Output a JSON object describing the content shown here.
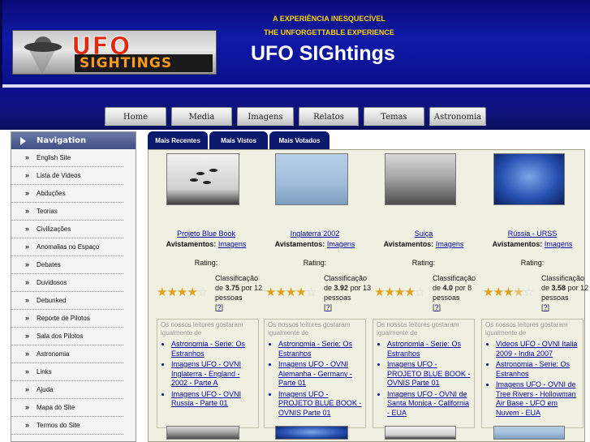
{
  "header": {
    "logo_ufo": "UFO",
    "logo_sightings": "SIGHTINGS",
    "tagline_pt": "A EXPERIÊNCIA INESQUECÍVEL",
    "tagline_en": "THE UNFORGETTABLE EXPERIENCE",
    "title": "UFO SIGhtings"
  },
  "nav_tabs": [
    "Home",
    "Media",
    "Imagens",
    "Relatos",
    "Temas",
    "Astronomia"
  ],
  "sidebar": {
    "title": "Navigation",
    "items": [
      "English Site",
      "Lista de Videos",
      "Abduções",
      "Teorias",
      "Civilizações",
      "Anomalias no Espaço",
      "Debates",
      "Duvidosos",
      "Debunked",
      "Reporte de Pilotos",
      "Sala dos Pilotos",
      "Astronomia",
      "Links",
      "Ajuda",
      "Mapa do Site",
      "Termos do Site"
    ]
  },
  "main_tabs": [
    "Mais Recentes",
    "Mais Vistos",
    "Mais Votados"
  ],
  "common": {
    "views_label": "Avistamentos:",
    "rating_label": "Rating:",
    "classification_label": "Classificação de",
    "por": "por",
    "people": "pessoas",
    "help": "?",
    "related_header": "Os nossos leitores gostaram igualmente de"
  },
  "cards": [
    {
      "title": "Projeto Blue Book",
      "category": "Imagens",
      "score": "3.75",
      "votes": "12",
      "stars_filled": 4,
      "related": [
        "Astronomia - Serie: Os Estranhos",
        "Imagens UFO - OVNI Inglaterra - England - 2002 - Parte A",
        "Imagens UFO - OVNI Russia - Parte 01"
      ]
    },
    {
      "title": "Inglaterra 2002",
      "category": "Imagens",
      "score": "3.92",
      "votes": "13",
      "stars_filled": 4,
      "related": [
        "Astronomia - Serie: Os Estranhos",
        "Imagens UFO - OVNI Alemanha - Germany - Parte 01",
        "Imagens UFO - PROJETO BLUE BOOK - OVNIS Parte 01"
      ]
    },
    {
      "title": "Suiça",
      "category": "Imagens",
      "score": "4.0",
      "votes": "8",
      "stars_filled": 4,
      "related": [
        "Astronomia - Serie: Os Estranhos",
        "Imagens UFO - PROJETO BLUE BOOK - OVNIS Parte 01",
        "Imagens UFO - OVNI de Santa Monica - California - EUA"
      ]
    },
    {
      "title": "Rússia - URSS",
      "category": "Imagens",
      "score": "3.58",
      "votes": "12",
      "stars_filled": 3.5,
      "related": [
        "Videos UFO - OVNI Italia 2009 - India 2007",
        "Astronomia - Serie: Os Estranhos",
        "Imagens UFO - OVNI de Tree Rivers - Hollowman Air Base - UFO em Nuvem - EUA"
      ]
    }
  ]
}
